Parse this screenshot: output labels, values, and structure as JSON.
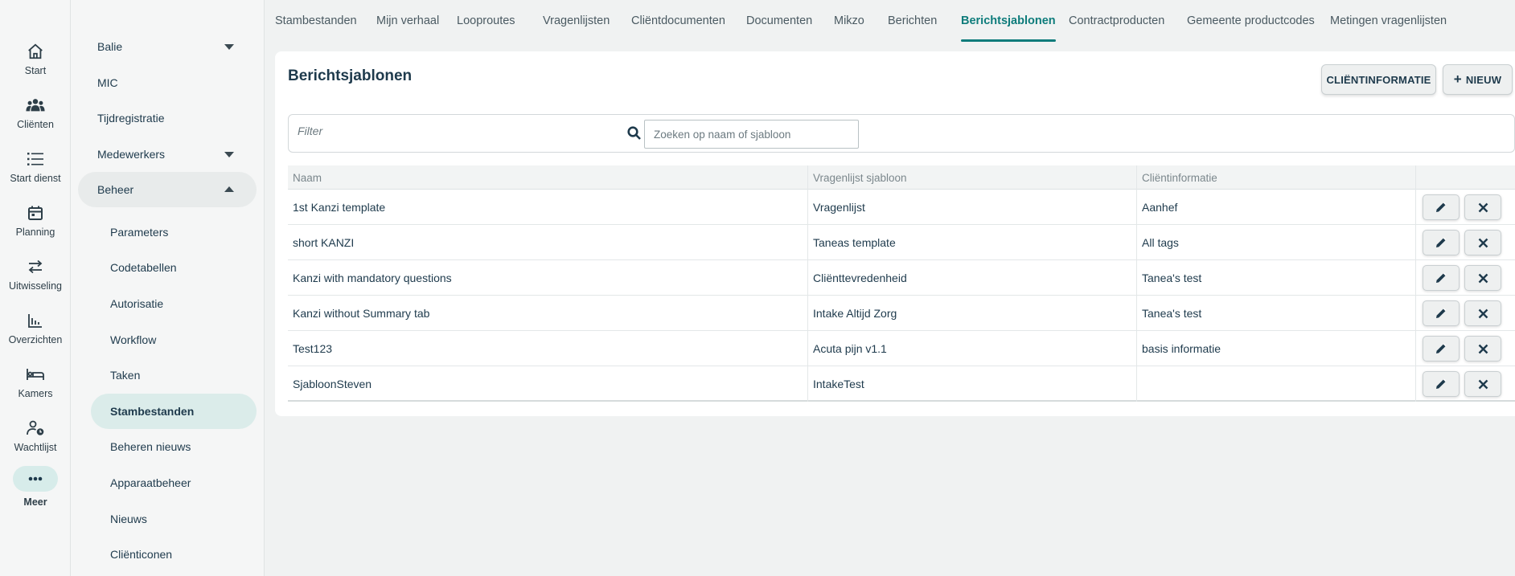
{
  "rail": {
    "items": [
      {
        "label": "Start",
        "icon": "home-icon"
      },
      {
        "label": "Cliënten",
        "icon": "clients-icon"
      },
      {
        "label": "Start dienst",
        "icon": "list-icon"
      },
      {
        "label": "Planning",
        "icon": "calendar-icon"
      },
      {
        "label": "Uitwisseling",
        "icon": "exchange-icon"
      },
      {
        "label": "Overzichten",
        "icon": "chart-icon"
      },
      {
        "label": "Kamers",
        "icon": "bed-icon"
      },
      {
        "label": "Wachtlijst",
        "icon": "waitlist-icon"
      },
      {
        "label": "Meer",
        "icon": "more-icon"
      }
    ],
    "active": "Meer"
  },
  "submenu": {
    "top_items": [
      {
        "label": "Balie",
        "expand": "down"
      },
      {
        "label": "MIC"
      },
      {
        "label": "Tijdregistratie"
      },
      {
        "label": "Medewerkers",
        "expand": "down"
      },
      {
        "label": "Beheer",
        "expand": "up"
      }
    ],
    "beheer_items": [
      "Parameters",
      "Codetabellen",
      "Autorisatie",
      "Workflow",
      "Taken",
      "Stambestanden",
      "Beheren nieuws",
      "Apparaatbeheer",
      "Nieuws",
      "Cliënticonen"
    ],
    "selected": "Stambestanden"
  },
  "tabs": [
    "Stambestanden",
    "Mijn verhaal",
    "Looproutes",
    "Vragenlijsten",
    "Cliëntdocumenten",
    "Documenten",
    "Mikzo",
    "Berichten",
    "Berichtsjablonen",
    "Contractproducten",
    "Gemeente productcodes",
    "Metingen vragenlijsten"
  ],
  "active_tab": "Berichtsjablonen",
  "page": {
    "title": "Berichtsjablonen",
    "client_info_button": "CLIËNTINFORMATIE",
    "new_button": "NIEUW",
    "filter_label": "Filter",
    "search_placeholder": "Zoeken op naam of sjabloon"
  },
  "table": {
    "columns": [
      "Naam",
      "Vragenlijst sjabloon",
      "Cliëntinformatie"
    ],
    "rows": [
      {
        "naam": "1st Kanzi template",
        "sjabloon": "Vragenlijst",
        "info": "Aanhef"
      },
      {
        "naam": "short KANZI",
        "sjabloon": "Taneas template",
        "info": "All tags"
      },
      {
        "naam": "Kanzi with mandatory questions",
        "sjabloon": "Cliënttevredenheid",
        "info": "Tanea's test"
      },
      {
        "naam": "Kanzi without Summary tab",
        "sjabloon": "Intake Altijd Zorg",
        "info": "Tanea's test"
      },
      {
        "naam": "Test123",
        "sjabloon": "Acuta pijn v1.1",
        "info": "basis informatie"
      },
      {
        "naam": "SjabloonSteven",
        "sjabloon": "IntakeTest",
        "info": ""
      }
    ]
  },
  "colors": {
    "accent": "#0e7c7b",
    "text": "#1e3a4c",
    "selected_bg": "#dbecea"
  }
}
